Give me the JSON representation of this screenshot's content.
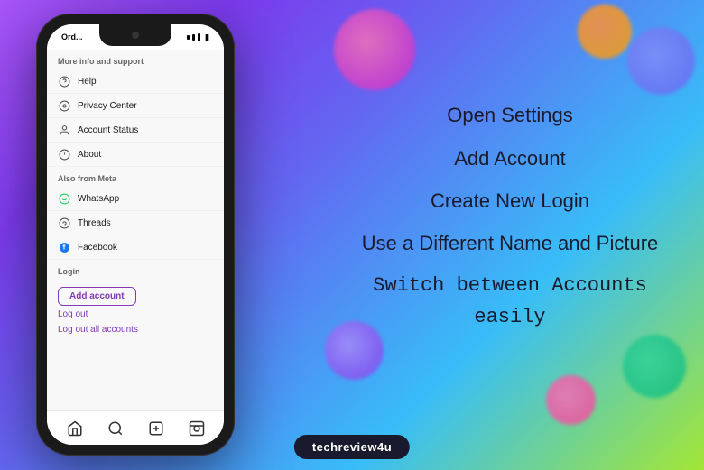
{
  "background": {
    "gradient": "purple to teal"
  },
  "phone": {
    "status_bar": {
      "time": "Ord...",
      "signal": "●●●"
    },
    "header": {
      "title": "Ord..."
    },
    "sections": [
      {
        "label": "More info and support",
        "items": [
          {
            "icon": "help-icon",
            "label": "Help"
          },
          {
            "icon": "privacy-icon",
            "label": "Privacy Center"
          },
          {
            "icon": "account-status-icon",
            "label": "Account Status"
          },
          {
            "icon": "about-icon",
            "label": "About"
          }
        ]
      },
      {
        "label": "Also from Meta",
        "items": [
          {
            "icon": "whatsapp-icon",
            "label": "WhatsApp"
          },
          {
            "icon": "threads-icon",
            "label": "Threads"
          },
          {
            "icon": "facebook-icon",
            "label": "Facebook"
          }
        ]
      }
    ],
    "login_section": {
      "label": "Login",
      "add_account_btn": "Add account",
      "log_out": "Log out",
      "log_out_all": "Log out all accounts"
    },
    "bottom_nav": [
      "home-icon",
      "search-icon",
      "add-icon",
      "reels-icon"
    ]
  },
  "features": [
    {
      "text": "Open Settings",
      "mono": false
    },
    {
      "text": "Add Account",
      "mono": false
    },
    {
      "text": "Create New Login",
      "mono": false
    },
    {
      "text": "Use a Different Name and Picture",
      "mono": false
    },
    {
      "text": "Switch between Accounts easily",
      "mono": true
    }
  ],
  "footer": {
    "badge": "techreview4u"
  }
}
